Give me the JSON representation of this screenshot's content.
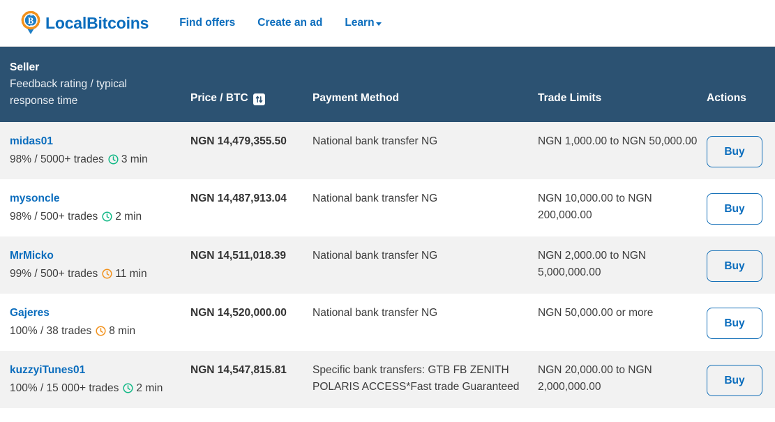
{
  "brand": {
    "name": "LocalBitcoins",
    "logo_icon": "bitcoin-map-pin-icon",
    "color": "#0b6dbd",
    "accent": "#f2911b"
  },
  "nav": {
    "links": [
      {
        "label": "Find offers",
        "has_caret": false
      },
      {
        "label": "Create an ad",
        "has_caret": false
      },
      {
        "label": "Learn",
        "has_caret": true
      }
    ]
  },
  "table": {
    "header": {
      "seller": "Seller",
      "seller_sub": "Feedback rating / typical response time",
      "price": "Price / BTC",
      "price_sort_icon": "sort-updown-icon",
      "payment": "Payment Method",
      "limits": "Trade Limits",
      "actions": "Actions",
      "background": "#2c5272"
    },
    "rows": [
      {
        "seller": "midas01",
        "rating": "98% / 5000+ trades",
        "clock_icon": "clock-icon",
        "response_time": "3 min",
        "response_color": "#12b886",
        "price": "NGN 14,479,355.50",
        "payment": "National bank transfer NG",
        "limits": "NGN 1,000.00 to NGN 50,000.00",
        "action": "Buy"
      },
      {
        "seller": "mysoncle",
        "rating": "98% / 500+ trades",
        "clock_icon": "clock-icon",
        "response_time": "2 min",
        "response_color": "#12b886",
        "price": "NGN 14,487,913.04",
        "payment": "National bank transfer NG",
        "limits": "NGN 10,000.00 to NGN 200,000.00",
        "action": "Buy"
      },
      {
        "seller": "MrMicko",
        "rating": "99% / 500+ trades",
        "clock_icon": "clock-icon",
        "response_time": "11 min",
        "response_color": "#f2911b",
        "price": "NGN 14,511,018.39",
        "payment": "National bank transfer NG",
        "limits": "NGN 2,000.00 to NGN 5,000,000.00",
        "action": "Buy"
      },
      {
        "seller": "Gajeres",
        "rating": "100% / 38 trades",
        "clock_icon": "clock-icon",
        "response_time": "8 min",
        "response_color": "#f2911b",
        "price": "NGN 14,520,000.00",
        "payment": "National bank transfer NG",
        "limits": "NGN 50,000.00 or more",
        "action": "Buy"
      },
      {
        "seller": "kuzzyiTunes01",
        "rating": "100% / 15 000+ trades",
        "clock_icon": "clock-icon",
        "response_time": "2 min",
        "response_color": "#12b886",
        "price": "NGN 14,547,815.81",
        "payment": "Specific bank transfers: GTB FB ZENITH POLARIS ACCESS*Fast trade Guaranteed",
        "limits": "NGN 20,000.00 to NGN 2,000,000.00",
        "action": "Buy"
      }
    ]
  }
}
